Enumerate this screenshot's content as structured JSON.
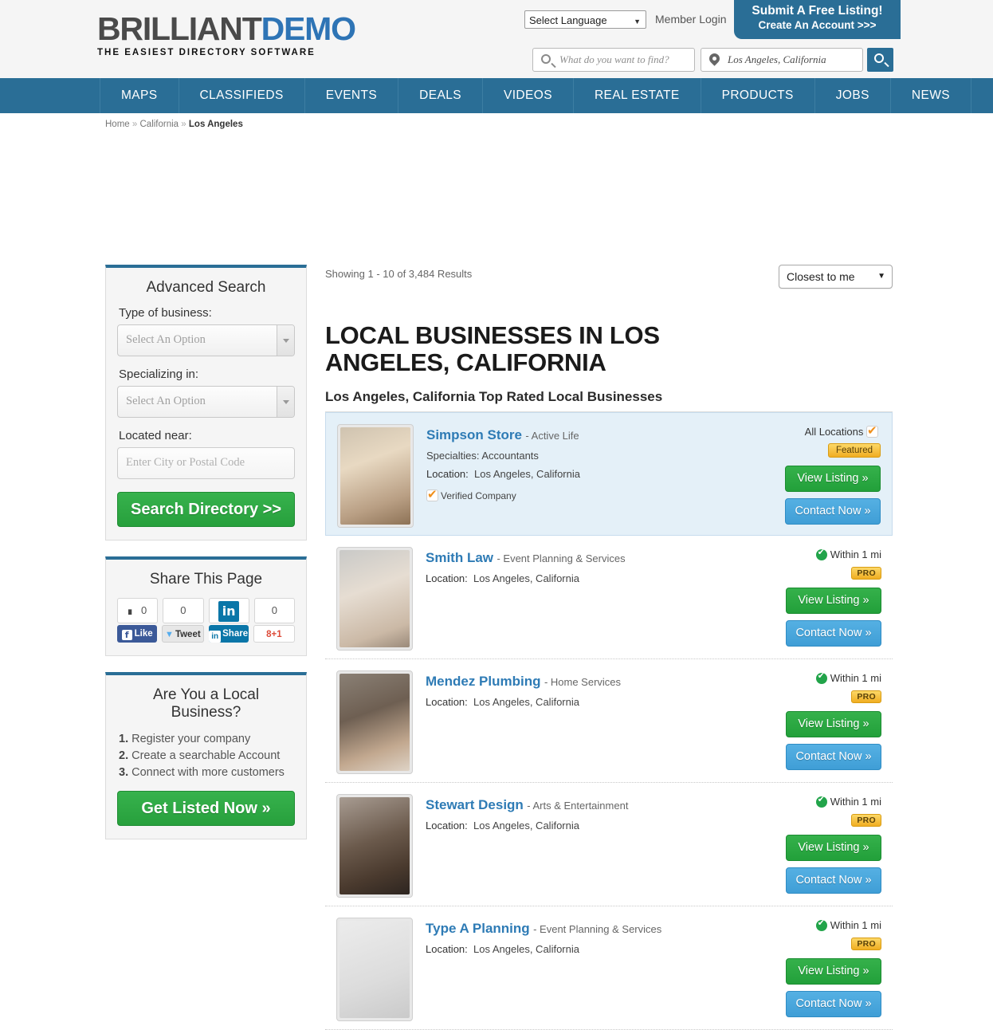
{
  "header": {
    "logo_primary": "BRILLIANT",
    "logo_secondary": "DEMO",
    "tagline": "THE EASIEST DIRECTORY SOFTWARE",
    "language_select": "Select Language",
    "member_login": "Member Login",
    "cta_line1": "Submit A Free Listing!",
    "cta_line2": "Create An Account >>>",
    "search_placeholder": "What do you want to find?",
    "location_value": "Los Angeles, California"
  },
  "nav": {
    "items": [
      {
        "label": "MAPS"
      },
      {
        "label": "CLASSIFIEDS"
      },
      {
        "label": "EVENTS"
      },
      {
        "label": "DEALS"
      },
      {
        "label": "VIDEOS"
      },
      {
        "label": "REAL ESTATE"
      },
      {
        "label": "PRODUCTS"
      },
      {
        "label": "JOBS"
      },
      {
        "label": "NEWS"
      }
    ]
  },
  "breadcrumb": {
    "home": "Home",
    "sep": "»",
    "state": "California",
    "city": "Los Angeles"
  },
  "sidebar": {
    "advanced_search": {
      "title": "Advanced Search",
      "type_label": "Type of business:",
      "type_value": "Select An Option",
      "spec_label": "Specializing in:",
      "spec_value": "Select An Option",
      "near_label": "Located near:",
      "near_placeholder": "Enter City or Postal Code",
      "submit_label": "Search Directory >>"
    },
    "share": {
      "title": "Share This Page",
      "facebook_count": "0",
      "twitter_count": "0",
      "linkedin_glyph": "in",
      "google_count": "0",
      "facebook_label": "Like",
      "facebook_glyph": "f",
      "twitter_label": "Tweet",
      "twitter_glyph": "🐦",
      "linkedin_label": "Share",
      "linkedin_btn_glyph": "in",
      "google_label": "+1",
      "google_glyph": "8"
    },
    "local_business": {
      "title": "Are You a Local Business?",
      "steps": [
        {
          "num": "1.",
          "text": "Register your company"
        },
        {
          "num": "2.",
          "text": "Create a searchable Account"
        },
        {
          "num": "3.",
          "text": "Connect with more customers"
        }
      ],
      "cta_label": "Get Listed Now »"
    }
  },
  "main": {
    "showing": "Showing 1 - 10 of 3,484 Results",
    "sort_value": "Closest to me",
    "page_title": "LOCAL BUSINESSES IN LOS ANGELES, CALIFORNIA",
    "subtitle": "Los Angeles, California Top Rated Local Businesses",
    "labels": {
      "location": "Location:",
      "specialties_prefix": "Specialties:",
      "verified": "Verified Company",
      "view_listing": "View Listing »",
      "contact_now": "Contact Now »"
    },
    "listings": [
      {
        "name": "Simpson Store",
        "category": "- Active Life",
        "specialties": "Specialties: Accountants",
        "location": "Los Angeles, California",
        "verified": "Verified Company",
        "distance": "All Locations",
        "badge": "Featured",
        "view": "View Listing »",
        "contact": "Contact Now »"
      },
      {
        "name": "Smith Law",
        "category": "- Event Planning & Services",
        "location": "Los Angeles, California",
        "distance": "Within 1 mi",
        "badge": "PRO",
        "view": "View Listing »",
        "contact": "Contact Now »"
      },
      {
        "name": "Mendez Plumbing",
        "category": "- Home Services",
        "location": "Los Angeles, California",
        "distance": "Within 1 mi",
        "badge": "PRO",
        "view": "View Listing »",
        "contact": "Contact Now »"
      },
      {
        "name": "Stewart Design",
        "category": "- Arts & Entertainment",
        "location": "Los Angeles, California",
        "distance": "Within 1 mi",
        "badge": "PRO",
        "view": "View Listing »",
        "contact": "Contact Now »"
      },
      {
        "name": "Type A Planning",
        "category": "- Event Planning & Services",
        "location": "Los Angeles, California",
        "distance": "Within 1 mi",
        "badge": "PRO",
        "view": "View Listing »",
        "contact": "Contact Now »"
      }
    ]
  },
  "colors": {
    "nav_blue": "#2a6e96",
    "link_blue": "#2e7bb5",
    "green": "#27a03c",
    "contact_blue": "#3f9ed6",
    "badge_gold": "#f0ad22",
    "featured_bg": "#e4f0f8"
  }
}
